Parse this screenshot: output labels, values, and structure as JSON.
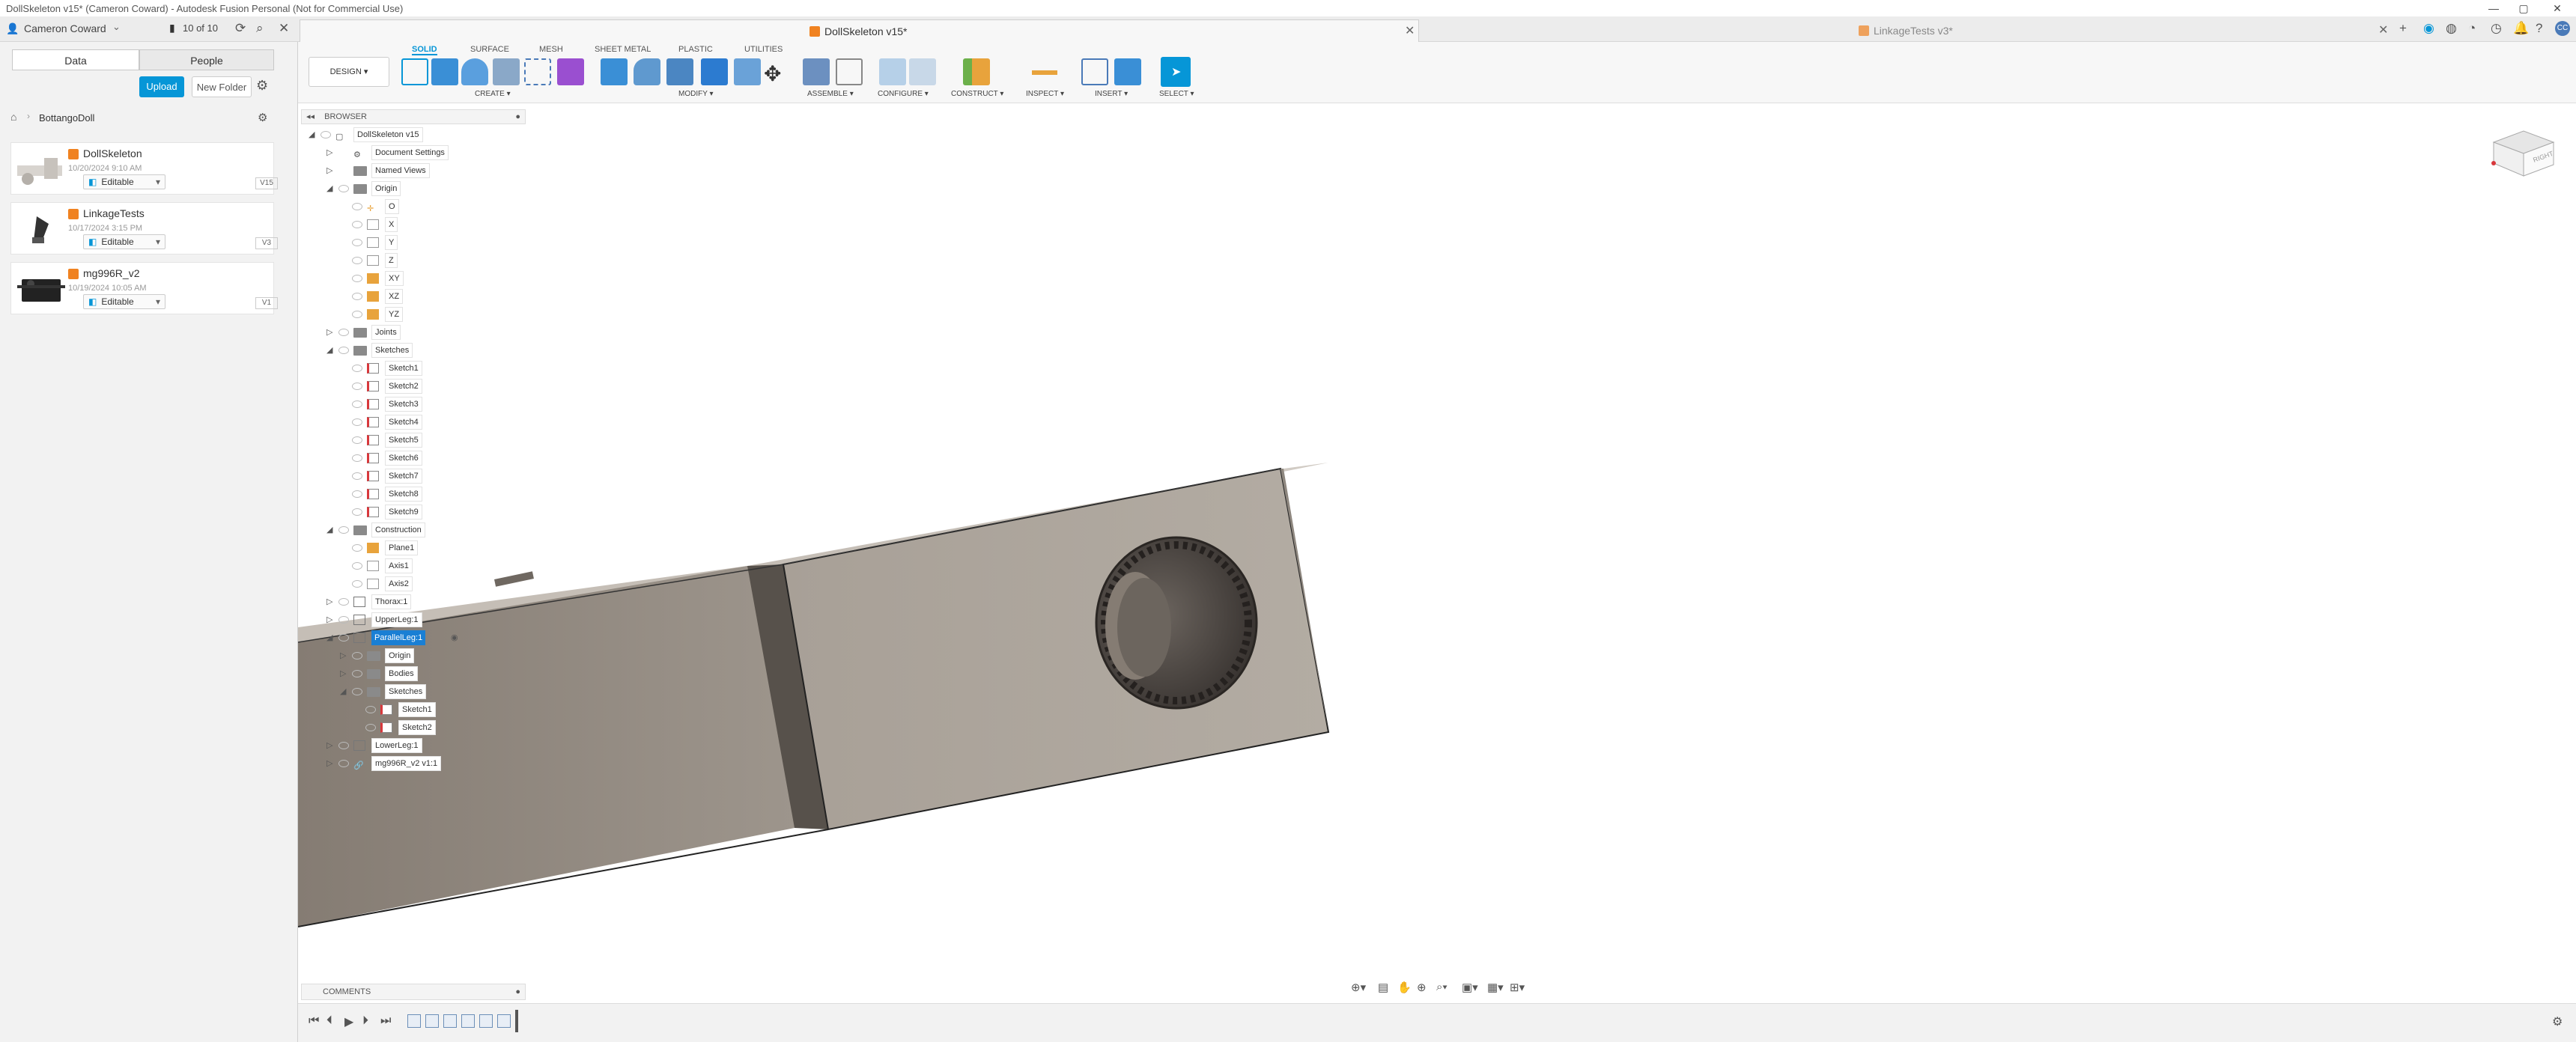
{
  "window": {
    "title": "DollSkeleton v15* (Cameron Coward) - Autodesk Fusion Personal (Not for Commercial Use)"
  },
  "appbar": {
    "user": "Cameron Coward",
    "jobs": "10 of 10"
  },
  "tabs": [
    {
      "label": "DollSkeleton v15*"
    },
    {
      "label": "LinkageTests v3*"
    }
  ],
  "left": {
    "data_tab": "Data",
    "people_tab": "People",
    "upload": "Upload",
    "new_folder": "New Folder",
    "breadcrumb": "BottangoDoll",
    "files": [
      {
        "name": "DollSkeleton",
        "date": "10/20/2024 9:10 AM",
        "status": "Editable",
        "version": "V15"
      },
      {
        "name": "LinkageTests",
        "date": "10/17/2024 3:15 PM",
        "status": "Editable",
        "version": "V3"
      },
      {
        "name": "mg996R_v2",
        "date": "10/19/2024 10:05 AM",
        "status": "Editable",
        "version": "V1"
      }
    ]
  },
  "toolbar": {
    "design": "DESIGN",
    "workspaces": [
      "SOLID",
      "SURFACE",
      "MESH",
      "SHEET METAL",
      "PLASTIC",
      "UTILITIES"
    ],
    "groups": [
      "CREATE",
      "MODIFY",
      "ASSEMBLE",
      "CONFIGURE",
      "CONSTRUCT",
      "INSPECT",
      "INSERT",
      "SELECT"
    ]
  },
  "browser": {
    "title": "BROWSER",
    "root": "DollSkeleton v15",
    "items": [
      "Document Settings",
      "Named Views",
      "Origin",
      "O",
      "X",
      "Y",
      "Z",
      "XY",
      "XZ",
      "YZ",
      "Joints",
      "Sketches",
      "Sketch1",
      "Sketch2",
      "Sketch3",
      "Sketch4",
      "Sketch5",
      "Sketch6",
      "Sketch7",
      "Sketch8",
      "Sketch9",
      "Construction",
      "Plane1",
      "Axis1",
      "Axis2",
      "Thorax:1",
      "UpperLeg:1",
      "ParallelLeg:1",
      "Origin",
      "Bodies",
      "Sketches",
      "Sketch1",
      "Sketch2",
      "LowerLeg:1",
      "mg996R_v2 v1:1"
    ]
  },
  "comments": {
    "title": "COMMENTS"
  },
  "viewcube": {
    "face": "RIGHT"
  },
  "colors": {
    "accent": "#0696d7",
    "selected": "#1a7fd4",
    "part": "#9d9489"
  }
}
